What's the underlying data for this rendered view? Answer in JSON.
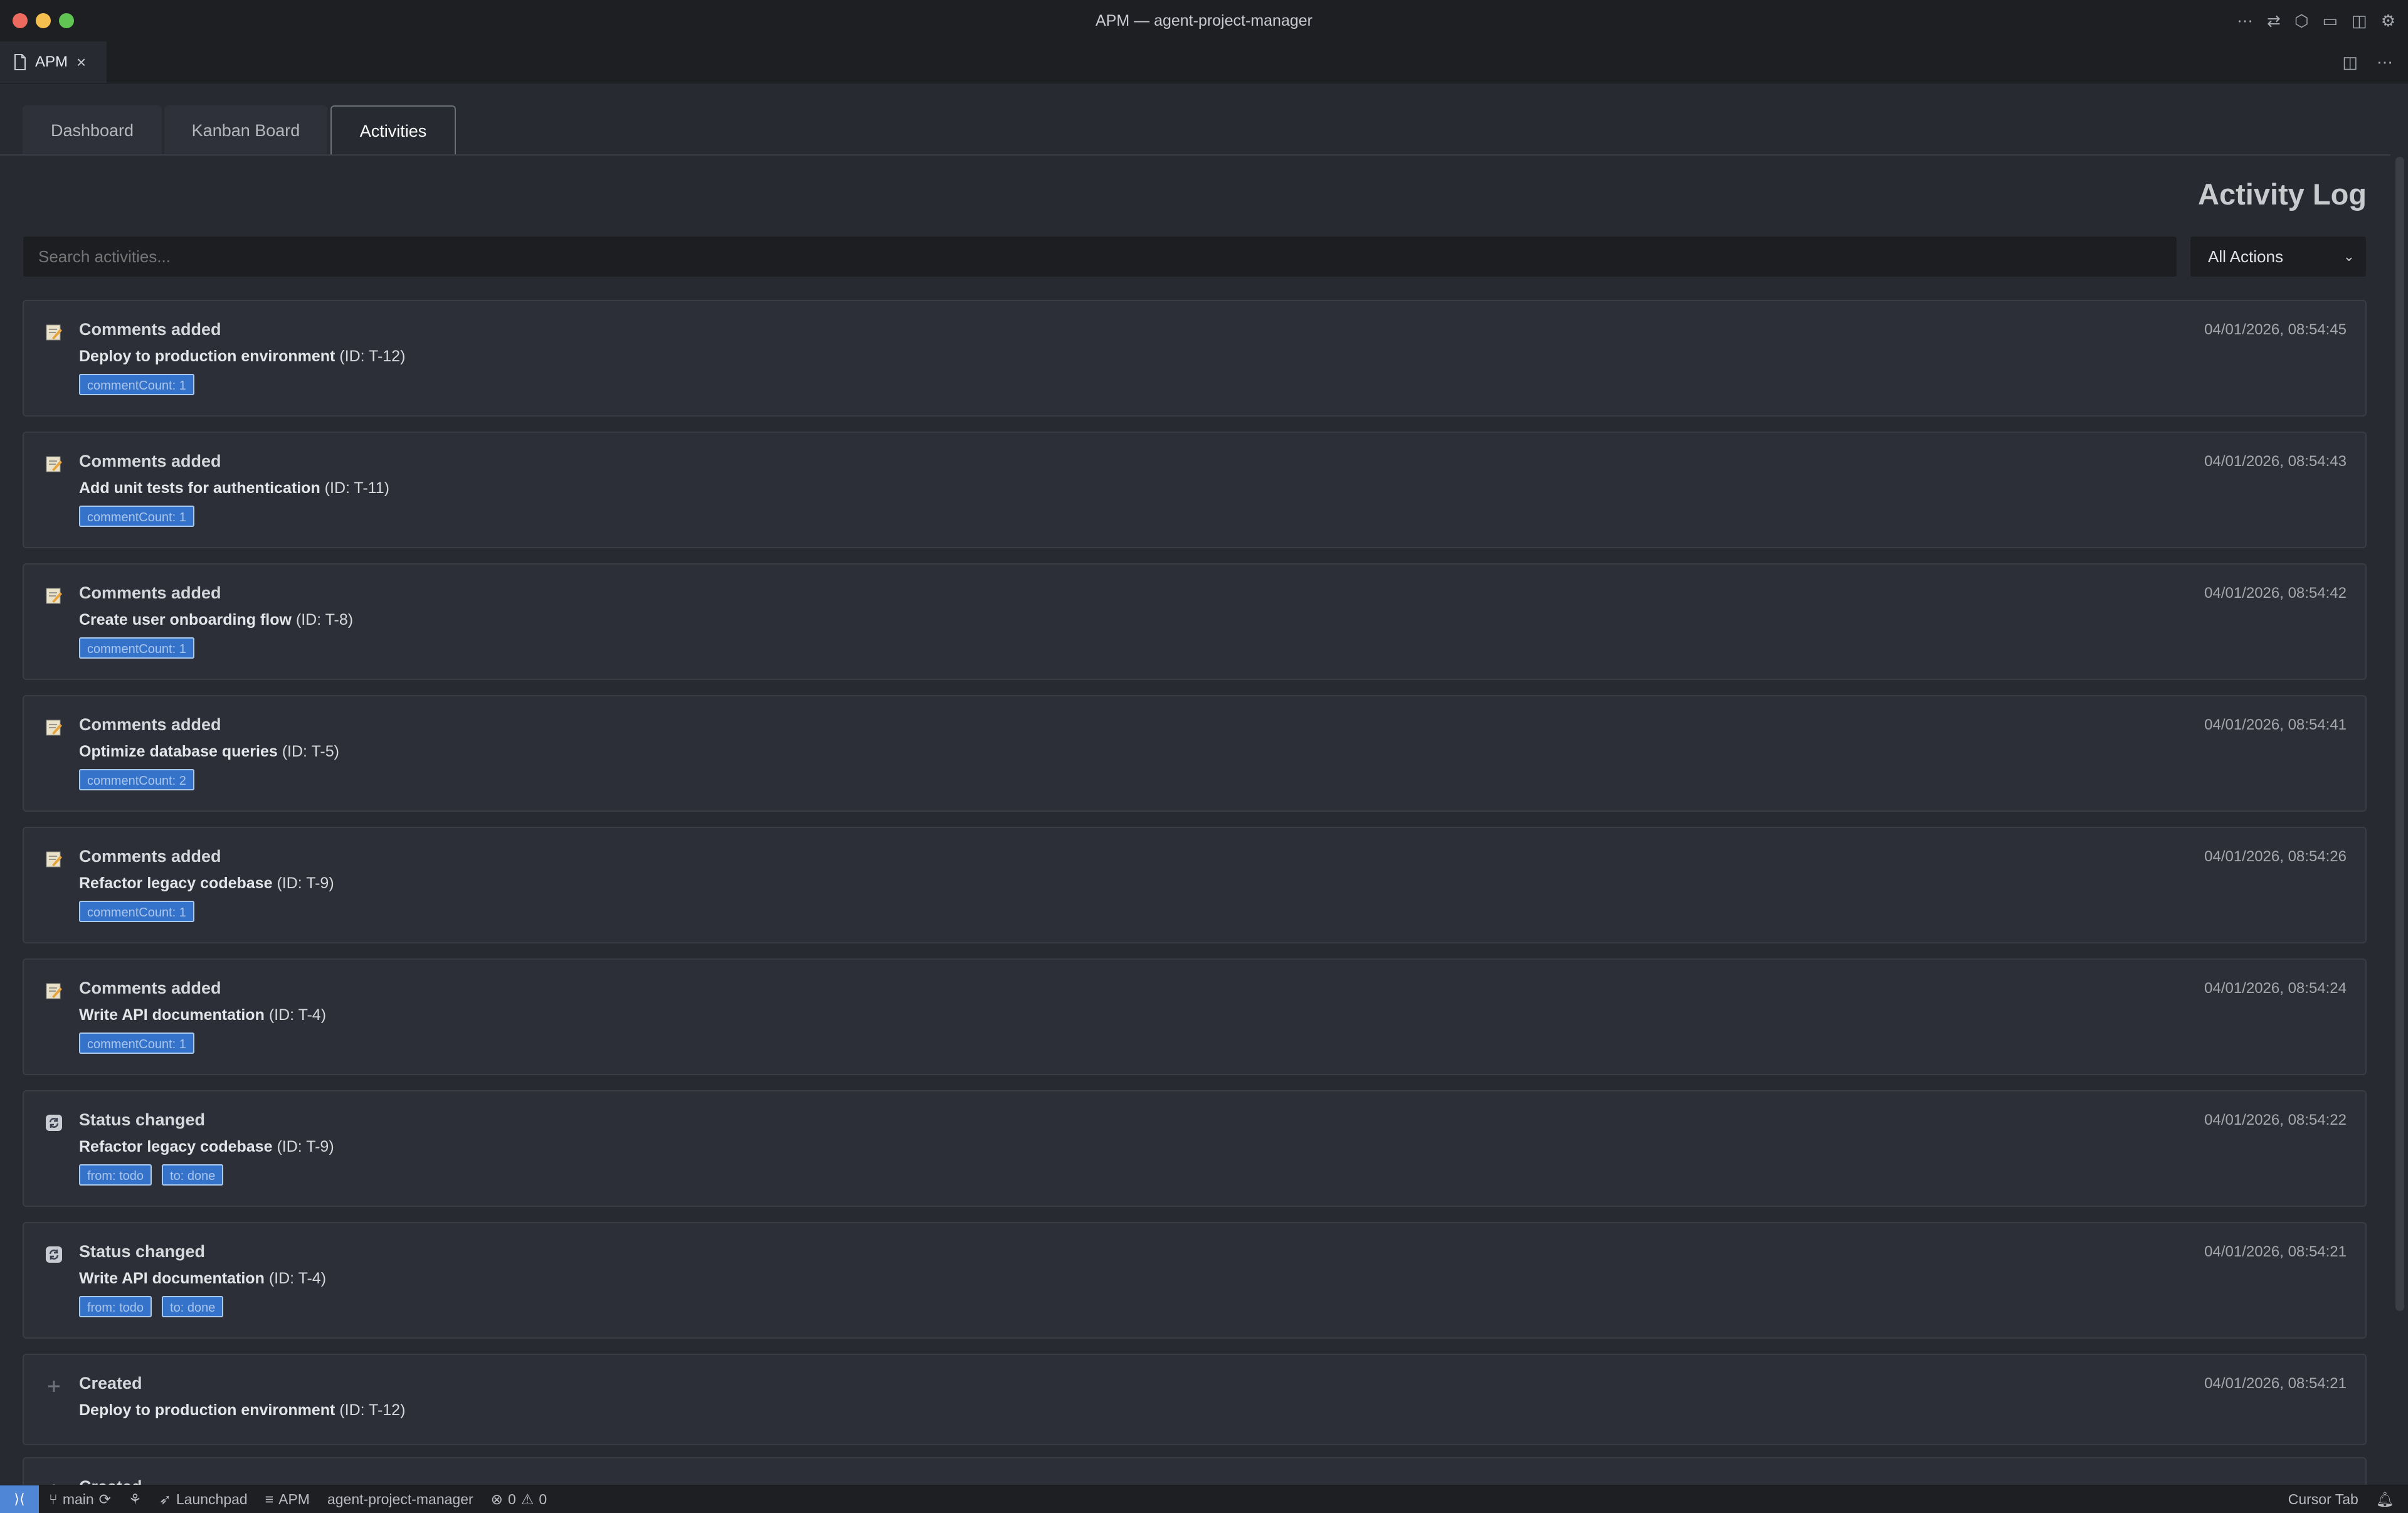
{
  "window": {
    "title": "APM — agent-project-manager"
  },
  "editor_tab": {
    "label": "APM"
  },
  "panel_tabs": [
    {
      "label": "Dashboard",
      "active": false
    },
    {
      "label": "Kanban Board",
      "active": false
    },
    {
      "label": "Activities",
      "active": true
    }
  ],
  "page": {
    "title": "Activity Log"
  },
  "search": {
    "placeholder": "Search activities..."
  },
  "filter": {
    "selected": "All Actions"
  },
  "activities": [
    {
      "icon": "memo-icon",
      "action": "Comments added",
      "task": "Deploy to production environment",
      "task_id": "(ID: T-12)",
      "time": "04/01/2026, 08:54:45",
      "tags": [
        "commentCount: 1"
      ]
    },
    {
      "icon": "memo-icon",
      "action": "Comments added",
      "task": "Add unit tests for authentication",
      "task_id": "(ID: T-11)",
      "time": "04/01/2026, 08:54:43",
      "tags": [
        "commentCount: 1"
      ]
    },
    {
      "icon": "memo-icon",
      "action": "Comments added",
      "task": "Create user onboarding flow",
      "task_id": "(ID: T-8)",
      "time": "04/01/2026, 08:54:42",
      "tags": [
        "commentCount: 1"
      ]
    },
    {
      "icon": "memo-icon",
      "action": "Comments added",
      "task": "Optimize database queries",
      "task_id": "(ID: T-5)",
      "time": "04/01/2026, 08:54:41",
      "tags": [
        "commentCount: 2"
      ]
    },
    {
      "icon": "memo-icon",
      "action": "Comments added",
      "task": "Refactor legacy codebase",
      "task_id": "(ID: T-9)",
      "time": "04/01/2026, 08:54:26",
      "tags": [
        "commentCount: 1"
      ]
    },
    {
      "icon": "memo-icon",
      "action": "Comments added",
      "task": "Write API documentation",
      "task_id": "(ID: T-4)",
      "time": "04/01/2026, 08:54:24",
      "tags": [
        "commentCount: 1"
      ]
    },
    {
      "icon": "refresh-icon",
      "action": "Status changed",
      "task": "Refactor legacy codebase",
      "task_id": "(ID: T-9)",
      "time": "04/01/2026, 08:54:22",
      "tags": [
        "from: todo",
        "to: done"
      ]
    },
    {
      "icon": "refresh-icon",
      "action": "Status changed",
      "task": "Write API documentation",
      "task_id": "(ID: T-4)",
      "time": "04/01/2026, 08:54:21",
      "tags": [
        "from: todo",
        "to: done"
      ]
    },
    {
      "icon": "plus-icon",
      "action": "Created",
      "task": "Deploy to production environment",
      "task_id": "(ID: T-12)",
      "time": "04/01/2026, 08:54:21",
      "tags": []
    },
    {
      "icon": "plus-icon",
      "action": "Created",
      "task": "",
      "task_id": "",
      "time": "",
      "tags": []
    }
  ],
  "statusbar": {
    "branch": "main",
    "launchpad": "Launchpad",
    "apm": "APM",
    "project": "agent-project-manager",
    "errors": "0",
    "warnings": "0",
    "cursor_tab": "Cursor Tab"
  },
  "colors": {
    "tag_bg": "#3572c9",
    "tag_border": "#a9c8ee",
    "accent": "#4f86d6"
  }
}
